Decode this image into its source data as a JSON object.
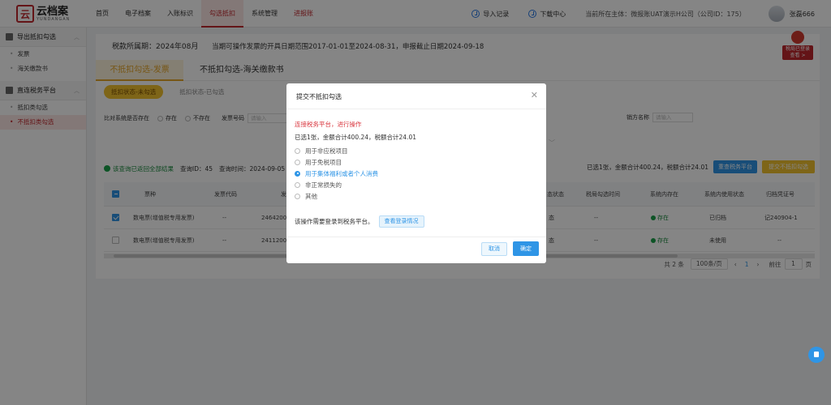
{
  "logo": {
    "cn": "云档案",
    "en": "YUNDANGAN",
    "mark": "云"
  },
  "nav": [
    "首页",
    "电子档案",
    "入账标识",
    "勾选抵扣",
    "系统管理",
    "进报账"
  ],
  "topbar": {
    "import": "导入记录",
    "download": "下载中心",
    "org": "当前所在主体：微报账UAT演示H公司（公司ID：175）",
    "user": "张磊666"
  },
  "sidebar": {
    "group1": "导出抵扣勾选",
    "items1": [
      "发票",
      "海关缴款书"
    ],
    "group2": "直连税务平台",
    "items2": [
      "抵扣类勾选",
      "不抵扣类勾选"
    ]
  },
  "main": {
    "period_label": "税款所属期：2024年08月",
    "period_desc": "当期可操作发票的开具日期范围2017-01-01至2024-08-31，申报截止日期2024-09-18",
    "seal_label": "税局已登录 查看 >",
    "tabs": [
      "不抵扣勾选-发票",
      "不抵扣勾选-海关缴款书"
    ],
    "subtabs": [
      "抵扣状态-未勾选",
      "抵扣状态-已勾选"
    ],
    "filters": {
      "foreign_label": "比对系统是否存在",
      "opt_yes": "存在",
      "opt_no": "不存在",
      "invoice_no_label": "发票号码",
      "invoice_no_placeholder": "请输入",
      "buyer_label": "销方名称",
      "buyer_placeholder": "请输入"
    },
    "result": {
      "ok_text": "该查询已返回全部结果",
      "query_id": "查询ID：45",
      "query_time": "查询时间：2024-09-05 15",
      "selected": "已选1张，金额合计400.24，税额合计24.01",
      "btn_refresh": "重查税务平台",
      "btn_submit": "提交不抵扣勾选"
    },
    "table": {
      "headers": [
        "票种",
        "发票代码",
        "发",
        "态状态",
        "税局勾选时间",
        "系统内存在",
        "系统内使用状态",
        "归档凭证号"
      ],
      "rows": [
        {
          "type": "数电票(增值税专用发票)",
          "code": "--",
          "num": "246420000",
          "status": "态",
          "time": "--",
          "exists": "存在",
          "use": "已归档",
          "voucher": "记240904-1"
        },
        {
          "type": "数电票(增值税专用发票)",
          "code": "--",
          "num": "24112000",
          "status": "态",
          "time": "--",
          "exists": "存在",
          "use": "未使用",
          "voucher": "--"
        }
      ]
    },
    "pager": {
      "total": "共 2 条",
      "size": "100条/页",
      "page": "1",
      "goto_label": "前往",
      "goto_value": "1",
      "goto_unit": "页"
    }
  },
  "modal": {
    "title": "提交不抵扣勾选",
    "warn": "连接税务平台，进行操作",
    "summary": "已选1张，金额合计400.24，税额合计24.01",
    "options": [
      "用于非应税项目",
      "用于免税项目",
      "用于集体福利或者个人消费",
      "非正常损失的",
      "其他"
    ],
    "selected_index": 2,
    "login_text": "该操作需要登录到税务平台。",
    "login_btn": "查看登录情况",
    "cancel": "取消",
    "ok": "确定"
  }
}
